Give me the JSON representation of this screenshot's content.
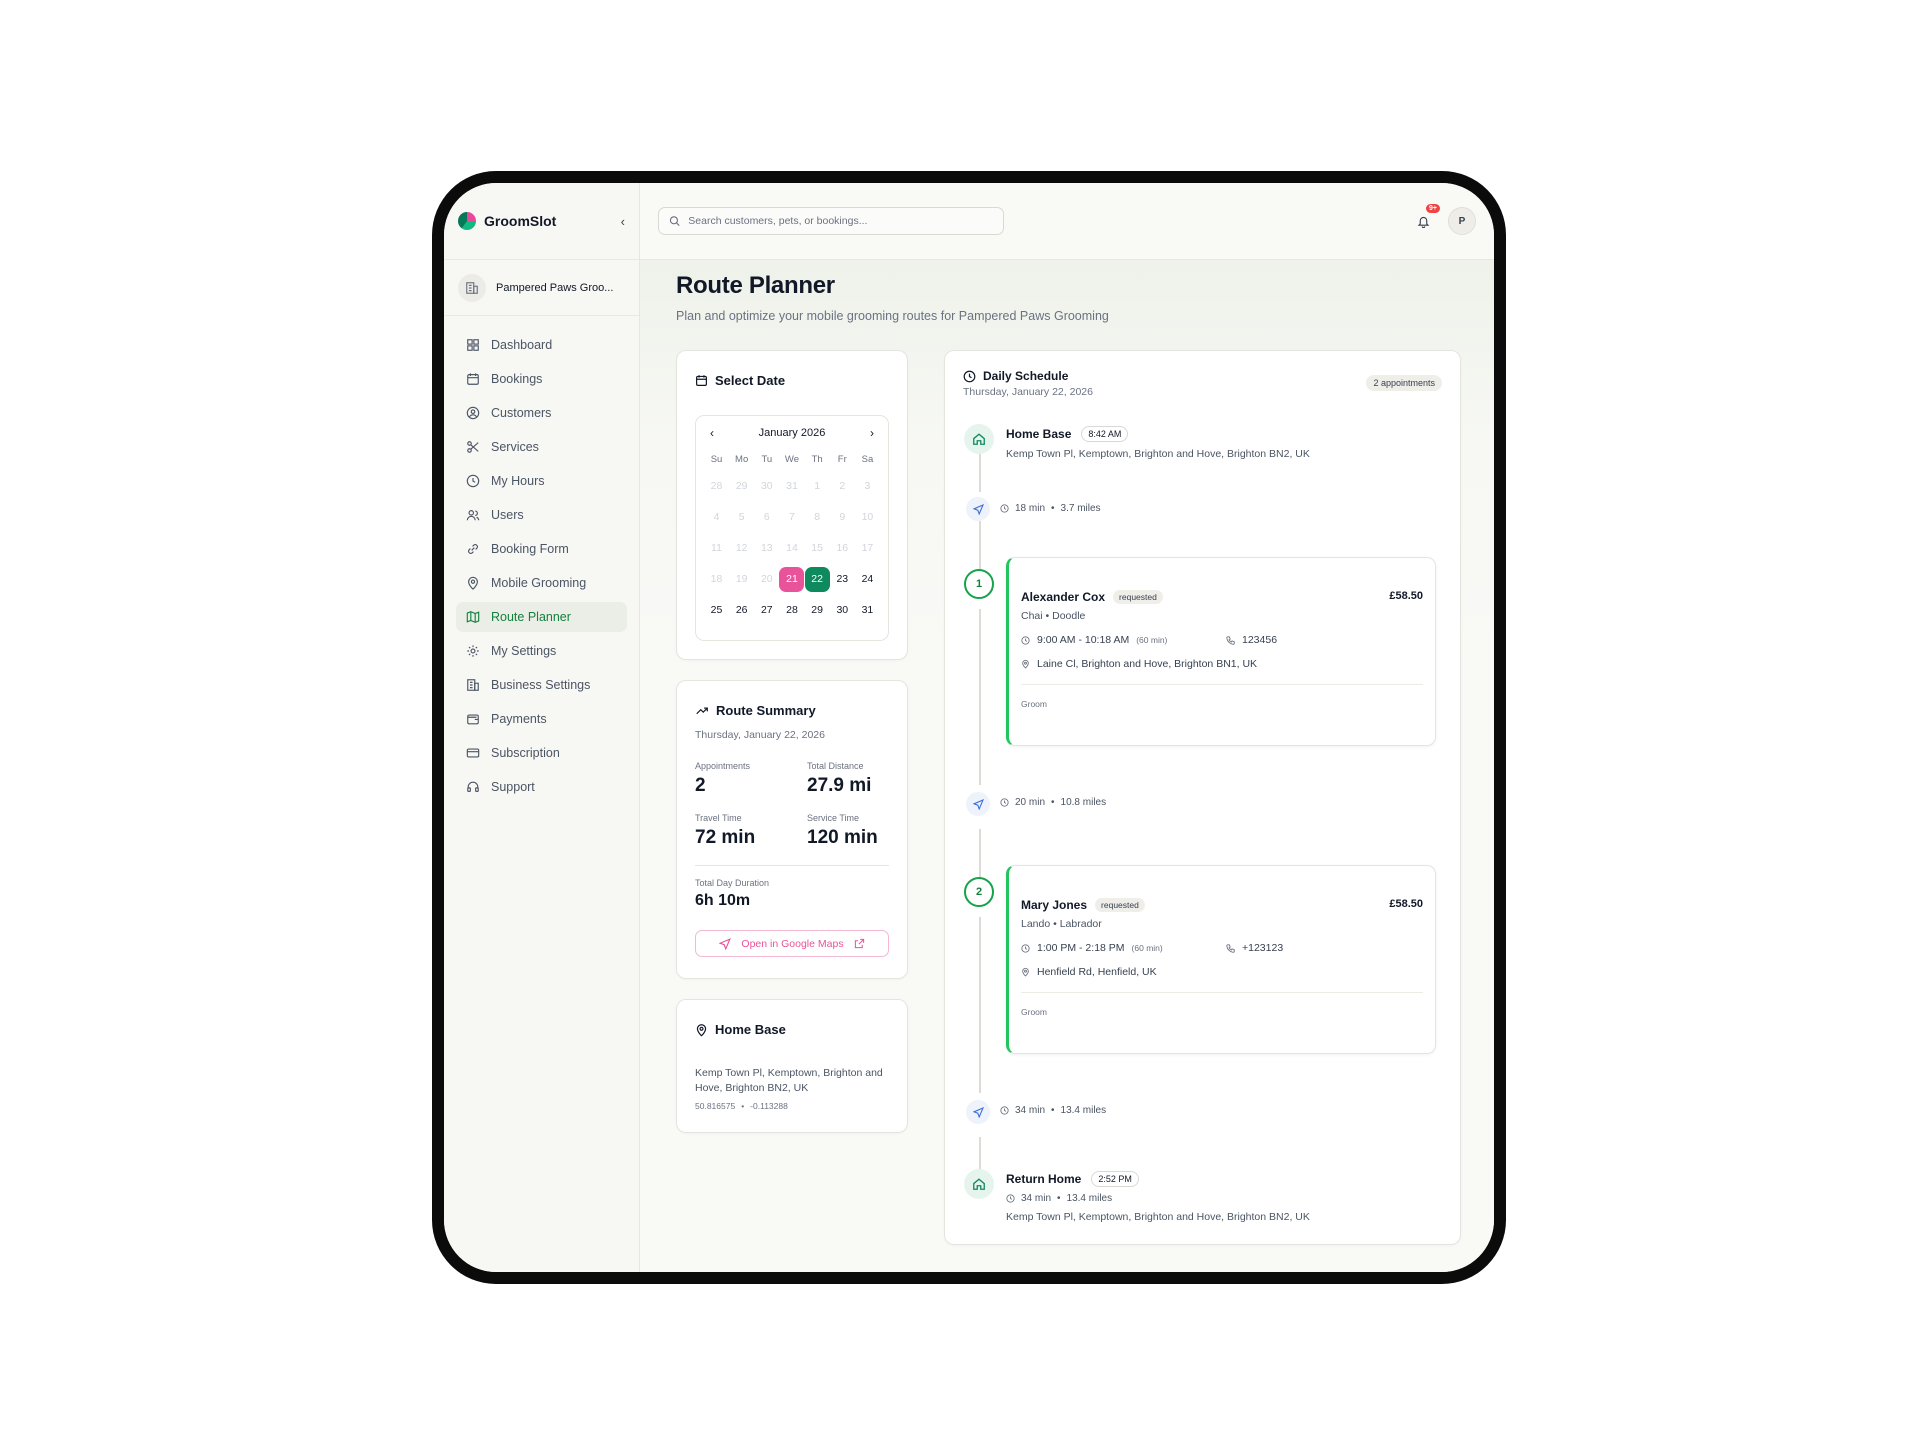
{
  "brand": {
    "name": "GroomSlot",
    "collapse_glyph": "‹"
  },
  "org": {
    "name": "Pampered Paws Groo..."
  },
  "nav": [
    {
      "label": "Dashboard",
      "icon": "dashboard-icon"
    },
    {
      "label": "Bookings",
      "icon": "calendar-icon"
    },
    {
      "label": "Customers",
      "icon": "user-circle-icon"
    },
    {
      "label": "Services",
      "icon": "scissors-icon"
    },
    {
      "label": "My Hours",
      "icon": "clock-icon"
    },
    {
      "label": "Users",
      "icon": "users-icon"
    },
    {
      "label": "Booking Form",
      "icon": "link-icon"
    },
    {
      "label": "Mobile Grooming",
      "icon": "map-pin-icon"
    },
    {
      "label": "Route Planner",
      "icon": "map-icon",
      "active": true
    },
    {
      "label": "My Settings",
      "icon": "gear-icon"
    },
    {
      "label": "Business Settings",
      "icon": "building-icon"
    },
    {
      "label": "Payments",
      "icon": "wallet-icon"
    },
    {
      "label": "Subscription",
      "icon": "credit-card-icon"
    },
    {
      "label": "Support",
      "icon": "headset-icon"
    }
  ],
  "search": {
    "placeholder": "Search customers, pets, or bookings..."
  },
  "notifications": {
    "count": "9+"
  },
  "user": {
    "initial": "P"
  },
  "page": {
    "title": "Route Planner",
    "subtitle": "Plan and optimize your mobile grooming routes for Pampered Paws Grooming"
  },
  "select_date": {
    "title": "Select Date",
    "month": "January 2026",
    "prev": "‹",
    "next": "›",
    "weekdays": [
      "Su",
      "Mo",
      "Tu",
      "We",
      "Th",
      "Fr",
      "Sa"
    ],
    "weeks": [
      [
        "28",
        "29",
        "30",
        "31",
        "1",
        "2",
        "3"
      ],
      [
        "4",
        "5",
        "6",
        "7",
        "8",
        "9",
        "10"
      ],
      [
        "11",
        "12",
        "13",
        "14",
        "15",
        "16",
        "17"
      ],
      [
        "18",
        "19",
        "20",
        "21",
        "22",
        "23",
        "24"
      ],
      [
        "25",
        "26",
        "27",
        "28",
        "29",
        "30",
        "31"
      ]
    ],
    "today": "21",
    "selected": "22"
  },
  "route_summary": {
    "title": "Route Summary",
    "date": "Thursday, January 22, 2026",
    "appointments_label": "Appointments",
    "appointments_value": "2",
    "distance_label": "Total Distance",
    "distance_value": "27.9 mi",
    "travel_label": "Travel Time",
    "travel_value": "72 min",
    "service_label": "Service Time",
    "service_value": "120 min",
    "duration_label": "Total Day Duration",
    "duration_value": "6h 10m",
    "maps_button": "Open in Google Maps"
  },
  "home_base_card": {
    "title": "Home Base",
    "address": "Kemp Town Pl, Kemptown, Brighton and Hove, Brighton BN2, UK",
    "lat": "50.816575",
    "lng": "-0.113288"
  },
  "schedule": {
    "title": "Daily Schedule",
    "date": "Thursday, January 22, 2026",
    "count_badge": "2 appointments",
    "home_base": {
      "title": "Home Base",
      "time": "8:42 AM",
      "address": "Kemp Town Pl, Kemptown, Brighton and Hove, Brighton BN2, UK"
    },
    "legs": [
      {
        "time": "18 min",
        "distance": "3.7 miles"
      },
      {
        "time": "20 min",
        "distance": "10.8 miles"
      },
      {
        "time": "34 min",
        "distance": "13.4 miles"
      }
    ],
    "appointments": [
      {
        "number": "1",
        "name": "Alexander Cox",
        "status": "requested",
        "price": "£58.50",
        "pet": "Chai • Doodle",
        "time": "9:00 AM - 10:18 AM",
        "duration": "(60 min)",
        "phone": "123456",
        "address": "Laine Cl, Brighton and Hove, Brighton BN1, UK",
        "service": "Groom"
      },
      {
        "number": "2",
        "name": "Mary Jones",
        "status": "requested",
        "price": "£58.50",
        "pet": "Lando • Labrador",
        "time": "1:00 PM - 2:18 PM",
        "duration": "(60 min)",
        "phone": "+123123",
        "address": "Henfield Rd, Henfield, UK",
        "service": "Groom"
      }
    ],
    "return_home": {
      "title": "Return Home",
      "time": "2:52 PM",
      "travel_time": "34 min",
      "travel_distance": "13.4 miles",
      "address": "Kemp Town Pl, Kemptown, Brighton and Hove, Brighton BN2, UK"
    }
  },
  "colors": {
    "accent": "#15803d",
    "pink": "#e8539a",
    "green_selected": "#0f8a5f",
    "appt_border": "#22c55e"
  }
}
